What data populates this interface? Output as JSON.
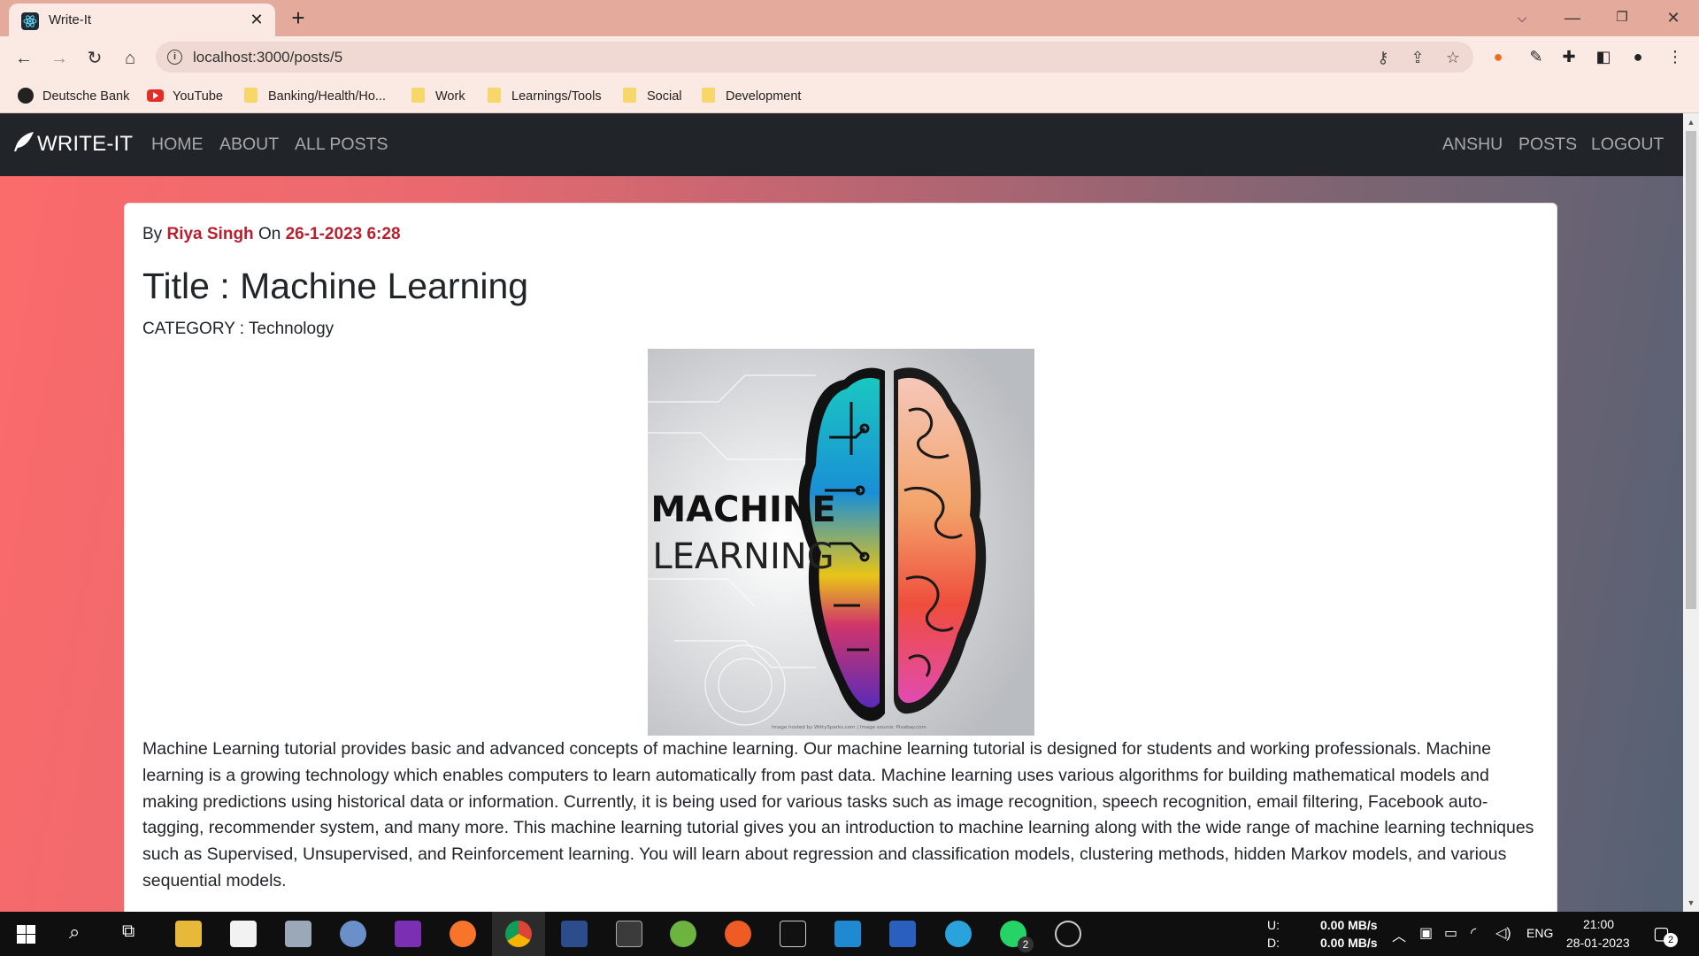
{
  "browser": {
    "tab_title": "Write-It",
    "tab_close": "✕",
    "new_tab": "+",
    "url": "localhost:3000/posts/5",
    "bookmarks": [
      {
        "label": "Deutsche Bank",
        "icon": "deutsche-bank-icon"
      },
      {
        "label": "YouTube",
        "icon": "youtube-icon"
      },
      {
        "label": "Banking/Health/Ho...",
        "icon": "folder-icon"
      },
      {
        "label": "Work",
        "icon": "folder-icon"
      },
      {
        "label": "Learnings/Tools",
        "icon": "folder-icon"
      },
      {
        "label": "Social",
        "icon": "folder-icon"
      },
      {
        "label": "Development",
        "icon": "folder-icon"
      }
    ]
  },
  "site": {
    "brand": "WRITE-IT",
    "nav_left": [
      "HOME",
      "ABOUT",
      "ALL POSTS"
    ],
    "nav_right": [
      "ANSHU",
      "POSTS",
      "LOGOUT"
    ]
  },
  "post": {
    "by_prefix": "By",
    "author": "Riya Singh",
    "on_word": "On",
    "date": "26-1-2023 6:28",
    "title": "Title : Machine Learning",
    "category": "CATEGORY : Technology",
    "image_text_line1": "MACHINE",
    "image_text_line2": "LEARNING",
    "image_credit": "Image hosted by WittySparks.com | Image source: Pixabay.com",
    "body": "Machine Learning tutorial provides basic and advanced concepts of machine learning. Our machine learning tutorial is designed for students and working professionals. Machine learning is a growing technology which enables computers to learn automatically from past data. Machine learning uses various algorithms for building mathematical models and making predictions using historical data or information. Currently, it is being used for various tasks such as image recognition, speech recognition, email filtering, Facebook auto-tagging, recommender system, and many more. This machine learning tutorial gives you an introduction to machine learning along with the wide range of machine learning techniques such as Supervised, Unsupervised, and Reinforcement learning. You will learn about regression and classification models, clustering methods, hidden Markov models, and various sequential models."
  },
  "taskbar": {
    "net_up_label": "U:",
    "net_down_label": "D:",
    "net_up": "0.00 MB/s",
    "net_down": "0.00 MB/s",
    "lang": "ENG",
    "time": "21:00",
    "date": "28-01-2023",
    "whatsapp_badge": "2",
    "notifications_badge": "2"
  },
  "colors": {
    "accent": "#b8202f",
    "navbar": "#212529",
    "gradient_start": "#fb6b6b",
    "gradient_end": "#556174"
  }
}
